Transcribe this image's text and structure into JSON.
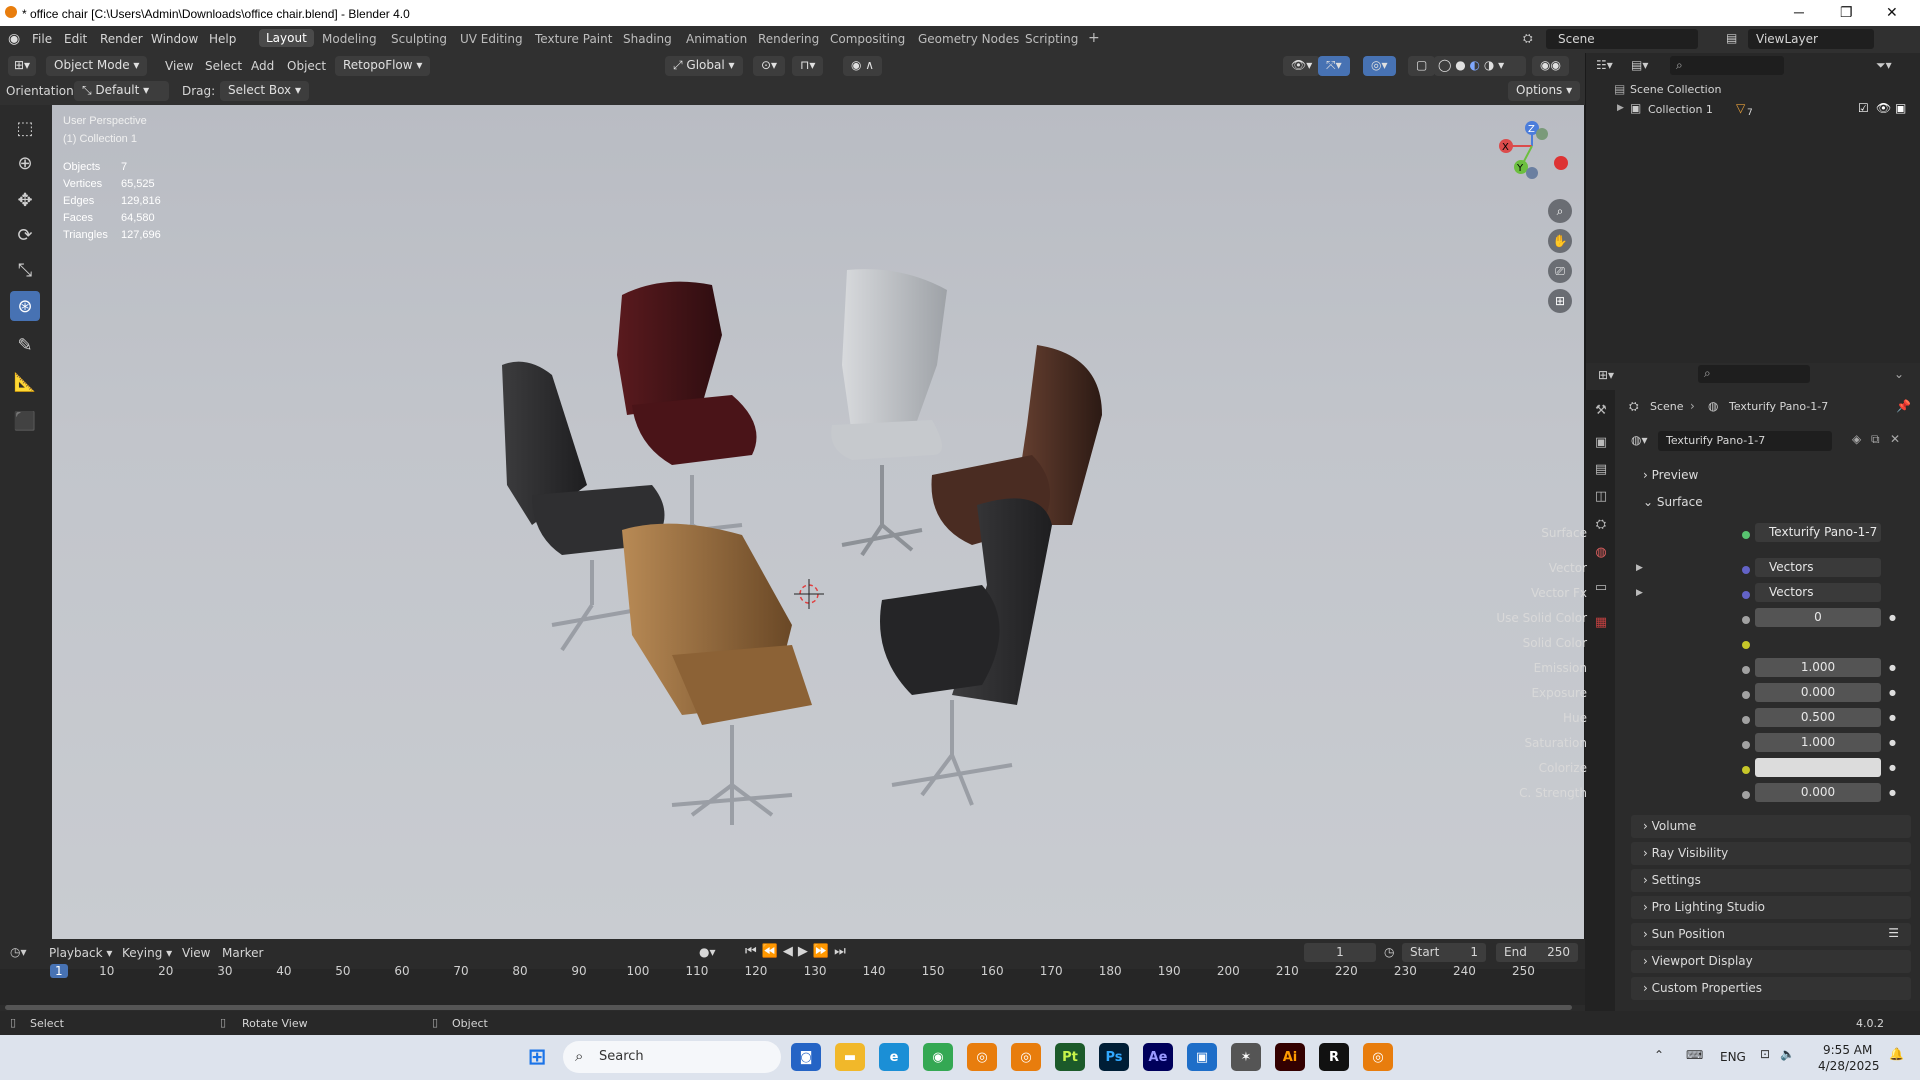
{
  "window": {
    "title": "* office chair [C:\\Users\\Admin\\Downloads\\office chair.blend] - Blender 4.0"
  },
  "menus": [
    "File",
    "Edit",
    "Render",
    "Window",
    "Help"
  ],
  "workspaces": [
    "Layout",
    "Modeling",
    "Sculpting",
    "UV Editing",
    "Texture Paint",
    "Shading",
    "Animation",
    "Rendering",
    "Compositing",
    "Geometry Nodes",
    "Scripting"
  ],
  "scene": {
    "name": "Scene",
    "viewlayer": "ViewLayer"
  },
  "header": {
    "mode": "Object Mode",
    "view": "View",
    "select": "Select",
    "add": "Add",
    "object": "Object",
    "addon": "RetopoFlow",
    "transform": "Global",
    "orientation_label": "Orientation:",
    "orientation": "Default",
    "drag_label": "Drag:",
    "drag": "Select Box",
    "options": "Options"
  },
  "viewport": {
    "perspective": "User Perspective",
    "collection": "(1) Collection 1",
    "stats": [
      {
        "k": "Objects",
        "v": "7"
      },
      {
        "k": "Vertices",
        "v": "65,525"
      },
      {
        "k": "Edges",
        "v": "129,816"
      },
      {
        "k": "Faces",
        "v": "64,580"
      },
      {
        "k": "Triangles",
        "v": "127,696"
      }
    ],
    "gizmo": {
      "x": "X",
      "y": "Y",
      "z": "Z"
    }
  },
  "outliner": {
    "root": "Scene Collection",
    "item": "Collection 1",
    "count": "7"
  },
  "properties": {
    "scene": "Scene",
    "world": "Texturify Pano-1-7",
    "world_field": "Texturify Pano-1-7",
    "sections_top": [
      "Preview",
      "Surface"
    ],
    "fields": [
      {
        "label": "Surface",
        "value": "Texturify Pano-1-7",
        "dot": "#58c270"
      },
      {
        "label": "Vector",
        "value": "Vectors",
        "dot": "#6363c7"
      },
      {
        "label": "Vector Fx",
        "value": "Vectors",
        "dot": "#6363c7"
      },
      {
        "label": "Use Solid Color",
        "value": "0",
        "dot": "#a1a1a1"
      },
      {
        "label": "Solid Color",
        "value": "",
        "dot": "#c7c729"
      },
      {
        "label": "Emission",
        "value": "1.000",
        "dot": "#a1a1a1"
      },
      {
        "label": "Exposure",
        "value": "0.000",
        "dot": "#a1a1a1"
      },
      {
        "label": "Hue",
        "value": "0.500",
        "dot": "#a1a1a1"
      },
      {
        "label": "Saturation",
        "value": "1.000",
        "dot": "#a1a1a1"
      },
      {
        "label": "Colorize",
        "value": "",
        "dot": "#c7c729"
      },
      {
        "label": "C. Strength",
        "value": "0.000",
        "dot": "#a1a1a1"
      }
    ],
    "sections": [
      "Volume",
      "Ray Visibility",
      "Settings",
      "Pro Lighting Studio",
      "Sun Position",
      "Viewport Display",
      "Custom Properties"
    ]
  },
  "timeline": {
    "playback": "Playback",
    "keying": "Keying",
    "view": "View",
    "marker": "Marker",
    "current": "1",
    "start_label": "Start",
    "start": "1",
    "end_label": "End",
    "end": "250",
    "ticks": [
      "1",
      "10",
      "20",
      "30",
      "40",
      "50",
      "60",
      "70",
      "80",
      "90",
      "100",
      "110",
      "120",
      "130",
      "140",
      "150",
      "160",
      "170",
      "180",
      "190",
      "200",
      "210",
      "220",
      "230",
      "240",
      "250"
    ]
  },
  "status": {
    "select": "Select",
    "rotate": "Rotate View",
    "object": "Object",
    "version": "4.0.2"
  },
  "taskbar": {
    "search": "Search",
    "lang": "ENG",
    "time": "9:55 AM",
    "date": "4/28/2025"
  }
}
